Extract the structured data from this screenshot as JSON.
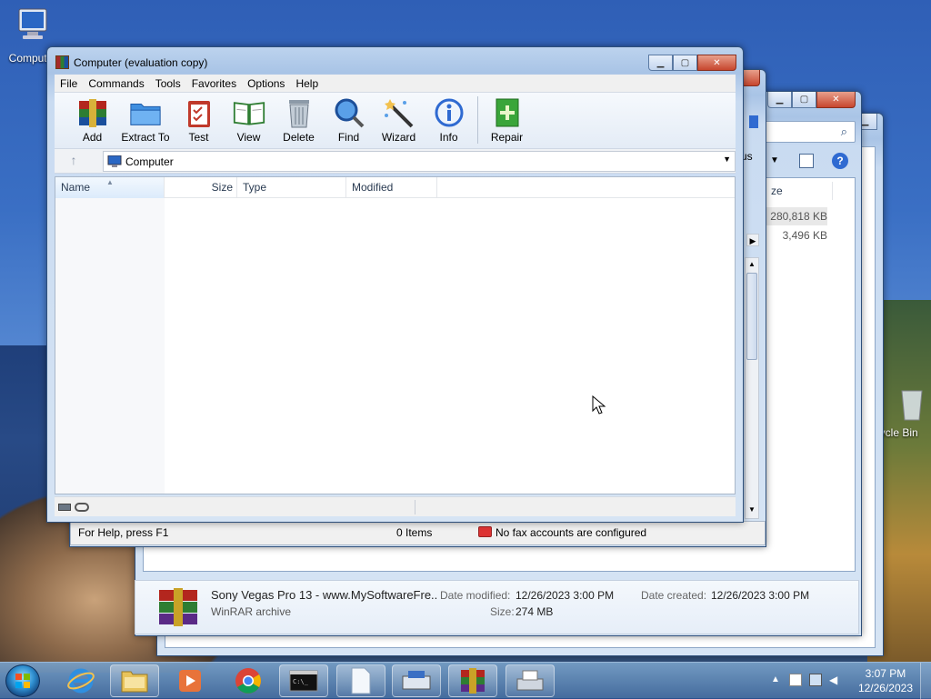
{
  "desktop": {
    "computer_icon_label": "Computer",
    "recycle_bin_label": "Recycle Bin"
  },
  "winrar": {
    "title": "Computer (evaluation copy)",
    "menu": [
      "File",
      "Commands",
      "Tools",
      "Favorites",
      "Options",
      "Help"
    ],
    "toolbar": {
      "add": "Add",
      "extract_to": "Extract To",
      "test": "Test",
      "view": "View",
      "delete": "Delete",
      "find": "Find",
      "wizard": "Wizard",
      "info": "Info",
      "repair": "Repair"
    },
    "address": "Computer",
    "columns": {
      "name": "Name",
      "size": "Size",
      "type": "Type",
      "modified": "Modified"
    }
  },
  "fax_window": {
    "help_text": "For Help, press F1",
    "items": "0 Items",
    "fax_status": "No fax accounts are configured",
    "partial_menu": "us"
  },
  "explorer": {
    "col_size_partial": "ze",
    "sizes": [
      "280,818 KB",
      "3,496 KB"
    ],
    "details": {
      "file_name": "Sony Vegas Pro 13 - www.MySoftwareFre...",
      "file_type": "WinRAR archive",
      "date_modified_label": "Date modified:",
      "date_modified": "12/26/2023 3:00 PM",
      "date_created_label": "Date created:",
      "date_created": "12/26/2023 3:00 PM",
      "size_label": "Size:",
      "size": "274 MB"
    }
  },
  "taskbar": {
    "time": "3:07 PM",
    "date": "12/26/2023"
  },
  "colors": {
    "accent": "#1a4f9c",
    "close_button": "#c7462e"
  }
}
